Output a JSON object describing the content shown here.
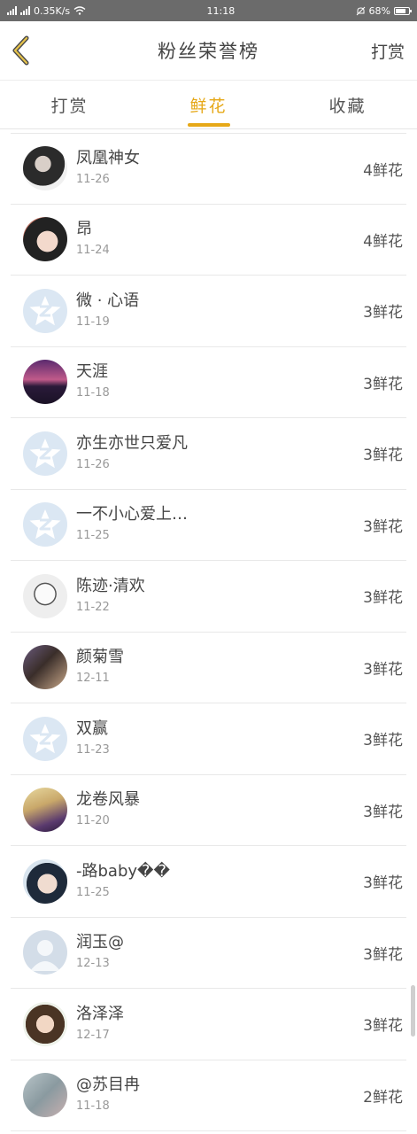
{
  "status": {
    "speed": "0.35K/s",
    "time": "11:18",
    "battery": "68%"
  },
  "nav": {
    "title": "粉丝荣誉榜",
    "action": "打赏"
  },
  "tabs": [
    {
      "label": "打赏",
      "active": false
    },
    {
      "label": "鲜花",
      "active": true
    },
    {
      "label": "收藏",
      "active": false
    }
  ],
  "colors": {
    "accent": "#e6a817",
    "text": "#444444",
    "sub": "#999999"
  },
  "fans": [
    {
      "name": "凤凰神女",
      "date": "11-26",
      "count": "4鲜花",
      "avatar": "photo-dark"
    },
    {
      "name": "昂",
      "date": "11-24",
      "count": "4鲜花",
      "avatar": "photo-girl"
    },
    {
      "name": "微 · 心语",
      "date": "11-19",
      "count": "3鲜花",
      "avatar": "default"
    },
    {
      "name": "天涯",
      "date": "11-18",
      "count": "3鲜花",
      "avatar": "photo-sunset"
    },
    {
      "name": "亦生亦世只爱凡",
      "date": "11-26",
      "count": "3鲜花",
      "avatar": "default"
    },
    {
      "name": "一不小心爱上…",
      "date": "11-25",
      "count": "3鲜花",
      "avatar": "default"
    },
    {
      "name": "陈迹·清欢",
      "date": "11-22",
      "count": "3鲜花",
      "avatar": "sketch"
    },
    {
      "name": "颜菊雪",
      "date": "12-11",
      "count": "3鲜花",
      "avatar": "photo-hair"
    },
    {
      "name": "双赢",
      "date": "11-23",
      "count": "3鲜花",
      "avatar": "default"
    },
    {
      "name": "龙卷风暴",
      "date": "11-20",
      "count": "3鲜花",
      "avatar": "photo-blonde"
    },
    {
      "name": "-路baby��",
      "date": "11-25",
      "count": "3鲜花",
      "avatar": "photo-boy"
    },
    {
      "name": "润玉@",
      "date": "12-13",
      "count": "3鲜花",
      "avatar": "silhouette"
    },
    {
      "name": "洛泽泽",
      "date": "12-17",
      "count": "3鲜花",
      "avatar": "illustration"
    },
    {
      "name": "@苏目冉",
      "date": "11-18",
      "count": "2鲜花",
      "avatar": "photo-blur"
    }
  ]
}
